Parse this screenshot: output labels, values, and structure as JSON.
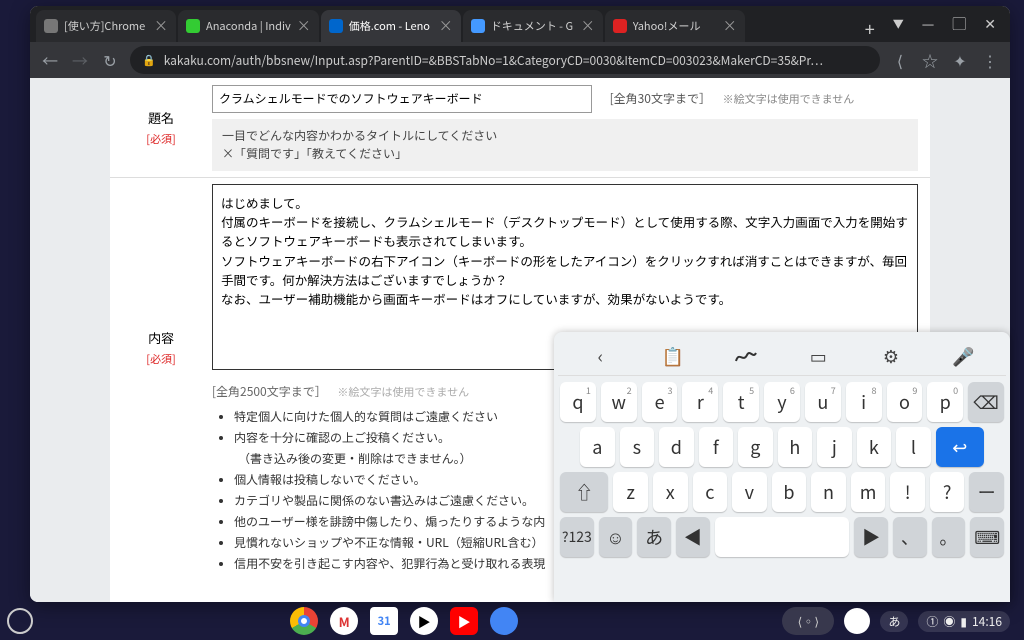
{
  "tabs": [
    {
      "title": "[使い方]Chrome",
      "icon": "globe"
    },
    {
      "title": "Anaconda | Indiv",
      "icon": "anaconda"
    },
    {
      "title": "価格.com - Leno",
      "icon": "kakaku",
      "active": true
    },
    {
      "title": "ドキュメント - G",
      "icon": "docs"
    },
    {
      "title": "Yahoo!メール",
      "icon": "yahoo"
    }
  ],
  "url": "kakaku.com/auth/bbsnew/Input.asp?ParentID=&BBSTabNo=1&CategoryCD=0030&ItemCD=003023&MakerCD=35&Pr…",
  "form": {
    "title_label": "題名",
    "required": "[必須]",
    "title_value": "クラムシェルモードでのソフトウェアキーボード",
    "title_hint1": "[全角30文字まで］",
    "title_hint2": "※絵文字は使用できません",
    "title_sub1": "一目でどんな内容かわかるタイトルにしてください",
    "title_sub2": "×「質問です」「教えてください」",
    "content_label": "内容",
    "content_value": "はじめまして。\n付属のキーボードを接続し、クラムシェルモード（デスクトップモード）として使用する際、文字入力画面で入力を開始するとソフトウェアキーボードも表示されてしまいます。\nソフトウェアキーボードの右下アイコン（キーボードの形をしたアイコン）をクリックすれば消すことはできますが、毎回手間です。何か解決方法はございますでしょうか？\nなお、ユーザー補助機能から画面キーボードはオフにしていますが、効果がないようです。\n",
    "content_hint1": "[全角2500文字まで］",
    "content_hint2": "※絵文字は使用できません",
    "rules": [
      "特定個人に向けた個人的な質問はご遠慮ください",
      "内容を十分に確認の上ご投稿ください。",
      "（書き込み後の変更・削除はできません。）",
      "個人情報は投稿しないでください。",
      "カテゴリや製品に関係のない書込みはご遠慮ください。",
      "他のユーザー様を誹謗中傷したり、煽ったりするような内",
      "見慣れないショップや不正な情報・URL（短縮URL含む）",
      "信用不安を引き起こす内容や、犯罪行為と受け取れる表現"
    ]
  },
  "keyboard": {
    "row1": [
      [
        "q",
        "1"
      ],
      [
        "w",
        "2"
      ],
      [
        "e",
        "3"
      ],
      [
        "r",
        "4"
      ],
      [
        "t",
        "5"
      ],
      [
        "y",
        "6"
      ],
      [
        "u",
        "7"
      ],
      [
        "i",
        "8"
      ],
      [
        "o",
        "9"
      ],
      [
        "p",
        "0"
      ]
    ],
    "row2": [
      "a",
      "s",
      "d",
      "f",
      "g",
      "h",
      "j",
      "k",
      "l"
    ],
    "row3": [
      "z",
      "x",
      "c",
      "v",
      "b",
      "n",
      "m",
      "!",
      "?"
    ],
    "bottom": {
      "sym": "?123",
      "lang": "あ"
    }
  },
  "shelf": {
    "ime": "あ",
    "time": "14:16",
    "battery": "1"
  }
}
